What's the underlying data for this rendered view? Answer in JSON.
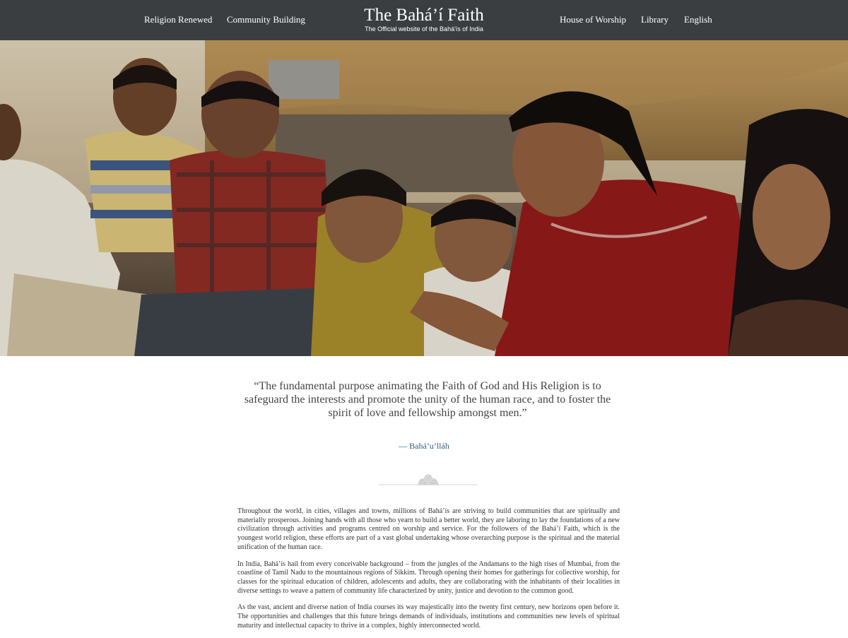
{
  "header": {
    "nav_left": [
      "Religion Renewed",
      "Community Building"
    ],
    "brand_title": "The Bahá’í Faith",
    "brand_subtitle": "The Official website of the Bahá'ís of India",
    "nav_right": [
      "House of Worship",
      "Library",
      "English"
    ]
  },
  "hero": {
    "alt": "A group of children and adults sitting together outdoors in a village"
  },
  "quote": {
    "text": "“The fundamental purpose animating the Faith of God and His Religion is to safeguard the interests and promote the unity of the human race, and to foster the spirit of love and fellowship amongst men.”",
    "attribution": "— Bahá’u’lláh"
  },
  "article": {
    "paragraphs": [
      "Throughout the world, in cities, villages and towns, millions of Bahá’ís are striving to build communities that are spiritually and materially prosperous. Joining hands with all those who yearn to build a better world, they are laboring to lay the foundations of a new civilization through activities and programs centred on worship and service. For the followers of the Bahá’í Faith, which is the youngest world religion, these efforts are part of a vast global undertaking whose overarching purpose is the spiritual and the material unification of the human race.",
      "In India, Bahá’ís hail from every conceivable background – from the jungles of the Andamans to the high rises of Mumbai, from the coastline of Tamil Nadu to the mountainous regions of Sikkim. Through opening their homes for gatherings for collective worship, for classes for the spiritual education of children, adolescents and adults, they are collaborating with the inhabitants of their localities in diverse settings to weave a pattern of community life characterized by unity, justice and devotion to the common good.",
      "As the vast, ancient and diverse nation of India courses its way majestically into the twenty first century, new horizons open before it. The opportunities and challenges that this future brings demands of individuals, institutions and communities new levels of spiritual maturity and intellectual capacity to thrive in a complex, highly interconnected world."
    ]
  },
  "colors": {
    "header_bg": "#3b3e41",
    "attribution": "#2f5f78"
  }
}
